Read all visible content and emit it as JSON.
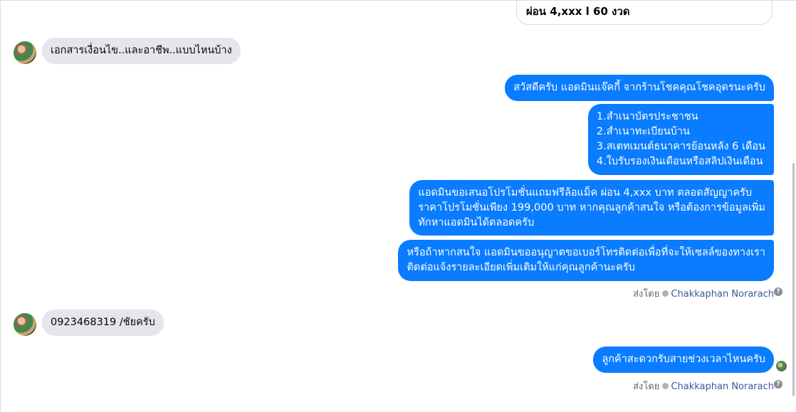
{
  "top_card": {
    "text": "ผ่อน 4,xxx l 60 งวด"
  },
  "messages": {
    "incoming_1": "เอกสารเงื่อนไข..และอาชีพ..แบบไหนบ้าง",
    "outgoing_1": "สวัสดีครับ แอดมินแจ๊คกี้ จากร้านโชคคุณโชคอุดรนะครับ",
    "outgoing_2": [
      "1.สำเนาบัตรประชาชน",
      "2.สำเนาทะเบียนบ้าน",
      "3.สเตทเมนต์ธนาคารย้อนหลัง 6 เดือน",
      "4.ใบรับรองเงินเดือนหรือสลิปเงินเดือน"
    ],
    "outgoing_3": [
      "แอดมินขอเสนอโปรโมชั่นแถมฟรีล้อแม็ค ผ่อน 4,xxx บาท ตลอดสัญญาครับ",
      "ราคาโปรโมชั่นเพียง 199,000 บาท หากคุณลูกค้าสนใจ หรือต้องการข้อมูลเพิ่ม",
      "ทักหาแอดมินได้ตลอดครับ"
    ],
    "outgoing_4": [
      "หรือถ้าหากสนใจ แอดมินขออนุญาตขอเบอร์โทรติดต่อเพื่อที่จะให้เซลล์ของทางเรา",
      "ติดต่อแจ้งรายละเอียดเพิ่มเติมให้แก่คุณลูกค้านะครับ"
    ],
    "incoming_2": "0923468319 /ชัยครับ",
    "outgoing_5": "ลูกค้าสะดวกรับสายช่วงเวลาไหนครับ"
  },
  "sent_by": {
    "label": "ส่งโดย",
    "name": "Chakkaphan Norarach",
    "help": "?"
  },
  "colors": {
    "outgoing_bubble": "#0a7cff",
    "incoming_bubble": "#e4e6eb",
    "sent_by_name": "#385898"
  }
}
